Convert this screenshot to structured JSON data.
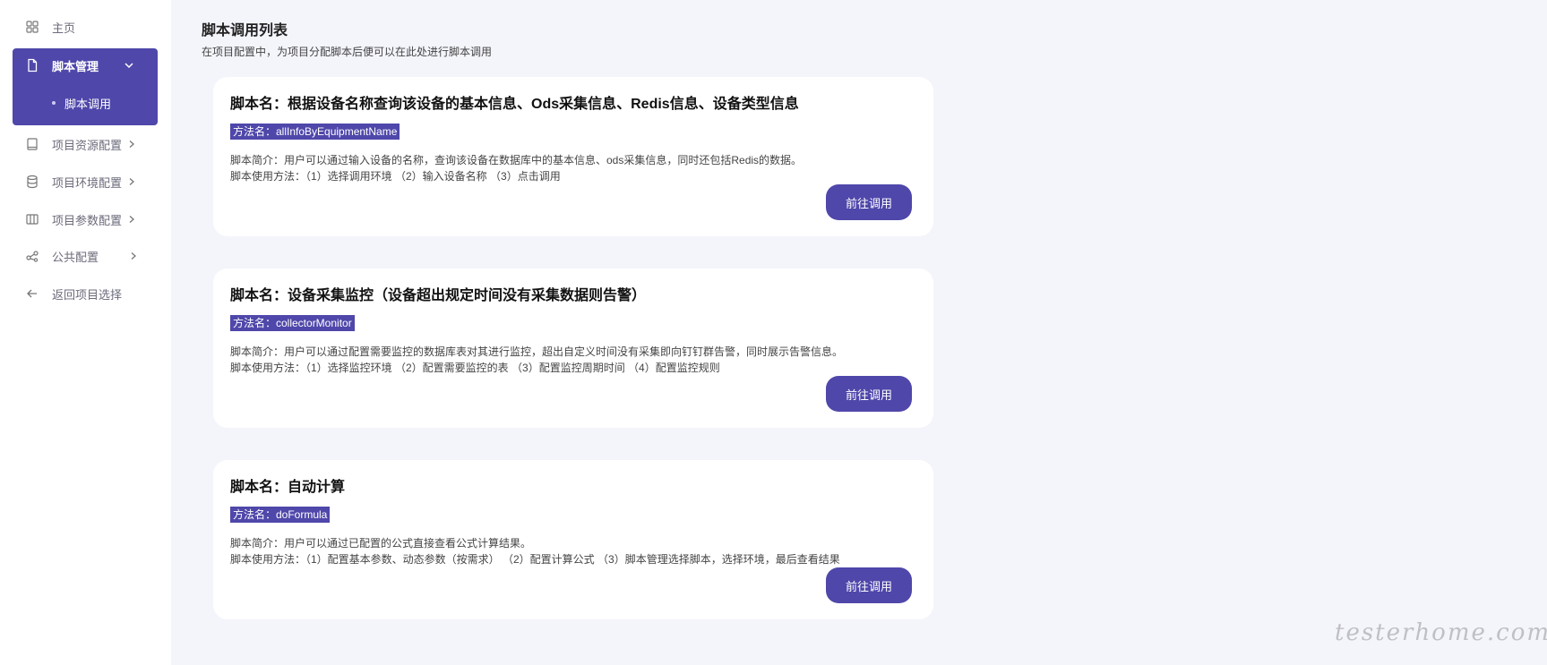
{
  "sidebar": {
    "home": {
      "label": "主页",
      "icon": "grid-icon"
    },
    "script_management": {
      "label": "脚本管理",
      "icon": "document-icon",
      "expanded": true,
      "children": [
        {
          "label": "脚本调用"
        }
      ]
    },
    "items": [
      {
        "label": "项目资源配置",
        "icon": "book-icon",
        "has_children": true
      },
      {
        "label": "项目环境配置",
        "icon": "database-icon",
        "has_children": true
      },
      {
        "label": "项目参数配置",
        "icon": "columns-icon",
        "has_children": true
      },
      {
        "label": "公共配置",
        "icon": "share-icon",
        "has_children": true
      },
      {
        "label": "返回项目选择",
        "icon": "arrow-left-icon",
        "has_children": false
      }
    ]
  },
  "main": {
    "title": "脚本调用列表",
    "description": "在项目配置中，为项目分配脚本后便可以在此处进行脚本调用",
    "cards": [
      {
        "name": "脚本名：根据设备名称查询该设备的基本信息、Ods采集信息、Redis信息、设备类型信息",
        "method": "方法名：allInfoByEquipmentName",
        "intro": "脚本简介：用户可以通过输入设备的名称，查询该设备在数据库中的基本信息、ods采集信息，同时还包括Redis的数据。",
        "usage": "脚本使用方法：（1）选择调用环境 （2）输入设备名称 （3）点击调用",
        "button": "前往调用"
      },
      {
        "name": "脚本名：设备采集监控（设备超出规定时间没有采集数据则告警）",
        "method": "方法名：collectorMonitor",
        "intro": "脚本简介：用户可以通过配置需要监控的数据库表对其进行监控，超出自定义时间没有采集即向钉钉群告警，同时展示告警信息。",
        "usage": "脚本使用方法：（1）选择监控环境 （2）配置需要监控的表 （3）配置监控周期时间 （4）配置监控规则",
        "button": "前往调用"
      },
      {
        "name": "脚本名：自动计算",
        "method": "方法名：doFormula",
        "intro": "脚本简介：用户可以通过已配置的公式直接查看公式计算结果。",
        "usage": "脚本使用方法：（1）配置基本参数、动态参数（按需求） （2）配置计算公式 （3）脚本管理选择脚本，选择环境，最后查看结果",
        "button": "前往调用"
      }
    ]
  },
  "watermark": "testerhome.com",
  "colors": {
    "accent": "#4f47aa",
    "background": "#f4f5fb",
    "card": "#ffffff"
  }
}
